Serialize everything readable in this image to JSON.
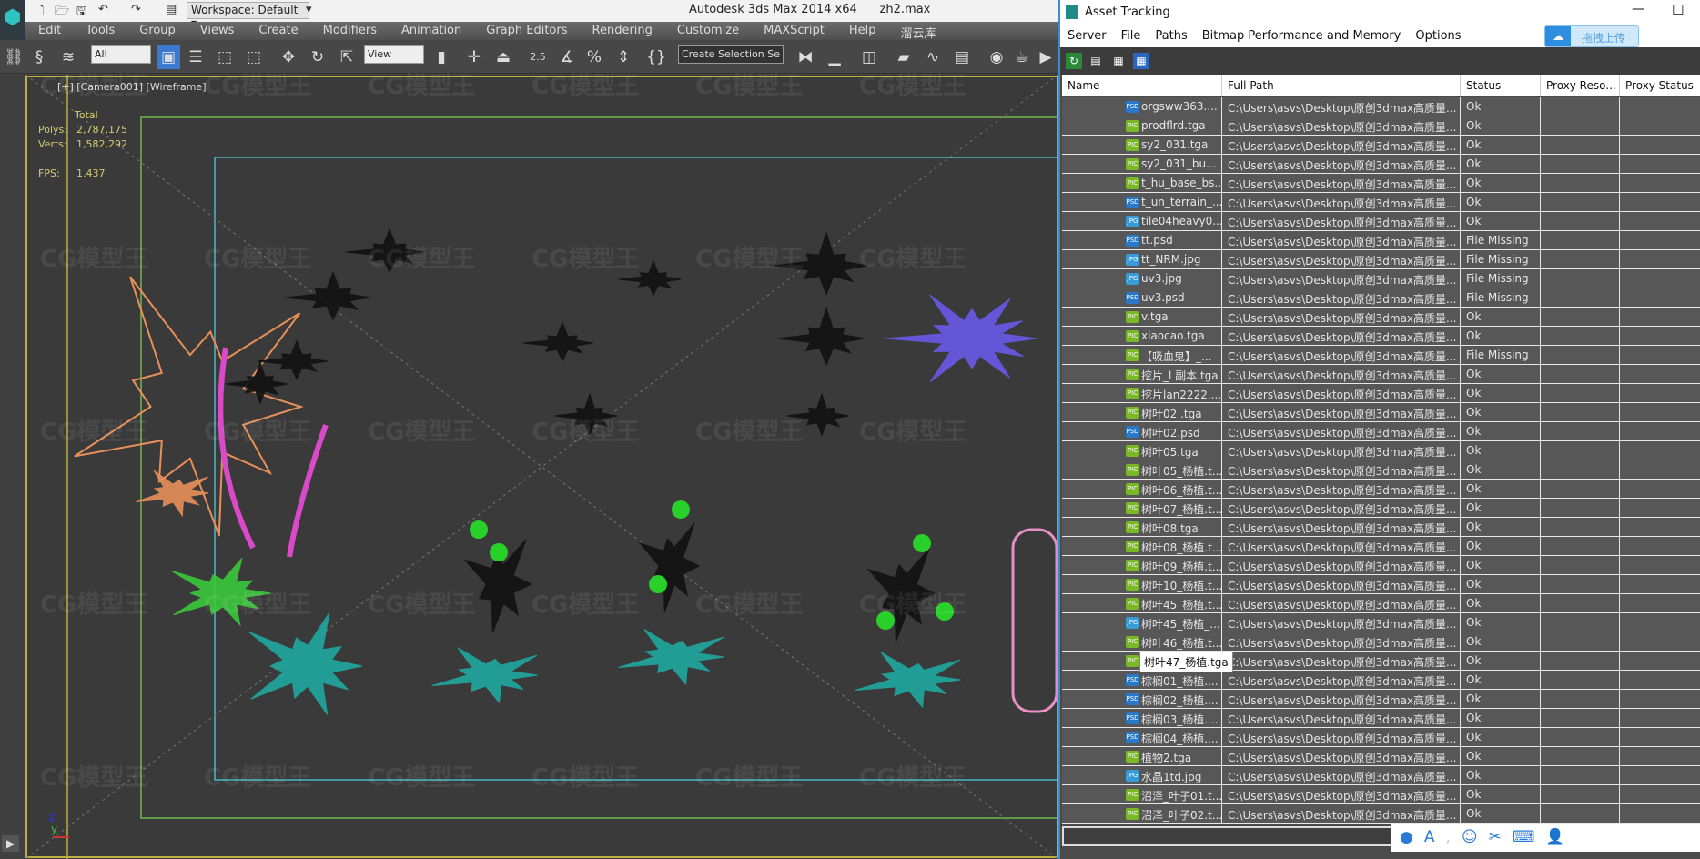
{
  "app": {
    "title": "Autodesk 3ds Max  2014 x64",
    "file": "zh2.max",
    "workspace": "Workspace: Default"
  },
  "menu": [
    "Edit",
    "Tools",
    "Group",
    "Views",
    "Create",
    "Modifiers",
    "Animation",
    "Graph Editors",
    "Rendering",
    "Customize",
    "MAXScript",
    "Help",
    "溜云库"
  ],
  "toolbar": {
    "filter": "All",
    "coord": "View",
    "snap_angle": "2.5",
    "selection_set": "Create Selection Se"
  },
  "viewport": {
    "label": "[+] [Camera001] [Wireframe]",
    "stats_header": "Total",
    "polys_label": "Polys:",
    "polys": "2,787,175",
    "verts_label": "Verts:",
    "verts": "1,582,292",
    "fps_label": "FPS:",
    "fps": "1.437",
    "axis": {
      "z": "z",
      "y": "y"
    }
  },
  "watermark": "CG模型王",
  "asset_tracking": {
    "title": "Asset Tracking",
    "menu": [
      "Server",
      "File",
      "Paths",
      "Bitmap Performance and Memory",
      "Options"
    ],
    "upload_button": "拖拽上传",
    "columns": [
      "Name",
      "Full Path",
      "Status",
      "Proxy Reso...",
      "Proxy Status"
    ],
    "path": "C:\\Users\\asvs\\Desktop\\原创3dmax高质量...",
    "tooltip": "树叶47_杨植.tga",
    "rows": [
      {
        "name": "orgsww363....",
        "type": "PSD",
        "status": "Ok"
      },
      {
        "name": "prodflrd.tga",
        "type": "PIC",
        "status": "Ok"
      },
      {
        "name": "sy2_031.tga",
        "type": "PIC",
        "status": "Ok"
      },
      {
        "name": "sy2_031_bu...",
        "type": "PIC",
        "status": "Ok"
      },
      {
        "name": "t_hu_base_bs...",
        "type": "PIC",
        "status": "Ok"
      },
      {
        "name": "t_un_terrain_...",
        "type": "PSD",
        "status": "Ok"
      },
      {
        "name": "tile04heavy0...",
        "type": "JPG",
        "status": "Ok"
      },
      {
        "name": "tt.psd",
        "type": "PSD",
        "status": "File Missing"
      },
      {
        "name": "tt_NRM.jpg",
        "type": "JPG",
        "status": "File Missing"
      },
      {
        "name": "uv3.jpg",
        "type": "JPG",
        "status": "File Missing"
      },
      {
        "name": "uv3.psd",
        "type": "PSD",
        "status": "File Missing"
      },
      {
        "name": "v.tga",
        "type": "PIC",
        "status": "Ok"
      },
      {
        "name": "xiaocao.tga",
        "type": "PIC",
        "status": "Ok"
      },
      {
        "name": "【吸血鬼】_...",
        "type": "PIC",
        "status": "File Missing"
      },
      {
        "name": "挖片_l 副本.tga",
        "type": "PIC",
        "status": "Ok"
      },
      {
        "name": "挖片lan2222....",
        "type": "PIC",
        "status": "Ok"
      },
      {
        "name": "树叶02 .tga",
        "type": "PIC",
        "status": "Ok"
      },
      {
        "name": "树叶02.psd",
        "type": "PSD",
        "status": "Ok"
      },
      {
        "name": "树叶05.tga",
        "type": "PIC",
        "status": "Ok"
      },
      {
        "name": "树叶05_杨植.t...",
        "type": "PIC",
        "status": "Ok"
      },
      {
        "name": "树叶06_杨植.t...",
        "type": "PIC",
        "status": "Ok"
      },
      {
        "name": "树叶07_杨植.t...",
        "type": "PIC",
        "status": "Ok"
      },
      {
        "name": "树叶08.tga",
        "type": "PIC",
        "status": "Ok"
      },
      {
        "name": "树叶08_杨植.t...",
        "type": "PIC",
        "status": "Ok"
      },
      {
        "name": "树叶09_杨植.t...",
        "type": "PIC",
        "status": "Ok"
      },
      {
        "name": "树叶10_杨植.t...",
        "type": "PIC",
        "status": "Ok"
      },
      {
        "name": "树叶45_杨植.t...",
        "type": "PIC",
        "status": "Ok"
      },
      {
        "name": "树叶45_杨植_...",
        "type": "JPG",
        "status": "Ok"
      },
      {
        "name": "树叶46_杨植.t...",
        "type": "PIC",
        "status": "Ok"
      },
      {
        "name": "",
        "type": "PIC",
        "status": "Ok"
      },
      {
        "name": "棕榈01_杨植....",
        "type": "PSD",
        "status": "Ok"
      },
      {
        "name": "棕榈02_杨植....",
        "type": "PSD",
        "status": "Ok"
      },
      {
        "name": "棕榈03_杨植....",
        "type": "PSD",
        "status": "Ok"
      },
      {
        "name": "棕榈04_杨植....",
        "type": "PSD",
        "status": "Ok"
      },
      {
        "name": "植物2.tga",
        "type": "PIC",
        "status": "Ok"
      },
      {
        "name": "水晶1td.jpg",
        "type": "JPG",
        "status": "Ok"
      },
      {
        "name": "沼泽_叶子01.t...",
        "type": "PIC",
        "status": "Ok"
      },
      {
        "name": "沼泽_叶子02.t...",
        "type": "PIC",
        "status": "Ok"
      }
    ]
  },
  "colors": {
    "PIC": "#7ab828",
    "PSD": "#2a78c8",
    "JPG": "#3a9ad8",
    "accent": "#3a8ad0",
    "stats": "#d8cc70"
  }
}
